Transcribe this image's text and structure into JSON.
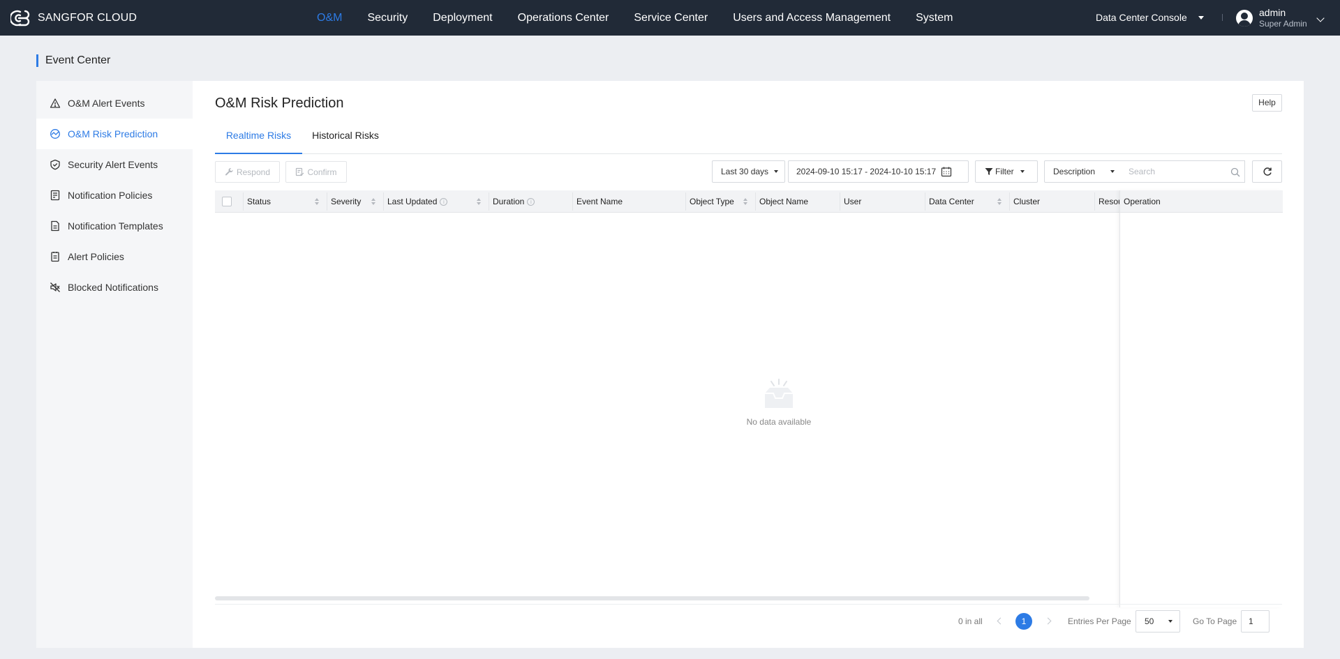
{
  "app": {
    "brand": "SANGFOR CLOUD"
  },
  "nav": {
    "items": [
      "O&M",
      "Security",
      "Deployment",
      "Operations Center",
      "Service Center",
      "Users and Access Management",
      "System"
    ],
    "active_index": 0,
    "console": "Data Center Console"
  },
  "user": {
    "name": "admin",
    "role": "Super Admin"
  },
  "page": {
    "title": "Event Center"
  },
  "sidebar": {
    "items": [
      {
        "label": "O&M Alert Events",
        "icon": "warning-icon"
      },
      {
        "label": "O&M Risk Prediction",
        "icon": "risk-icon"
      },
      {
        "label": "Security Alert Events",
        "icon": "shield-icon"
      },
      {
        "label": "Notification Policies",
        "icon": "notification-policy-icon"
      },
      {
        "label": "Notification Templates",
        "icon": "template-icon"
      },
      {
        "label": "Alert Policies",
        "icon": "alert-policy-icon"
      },
      {
        "label": "Blocked Notifications",
        "icon": "muted-speaker-icon"
      }
    ],
    "active_index": 1
  },
  "main": {
    "title": "O&M Risk Prediction",
    "help_label": "Help",
    "tabs": [
      "Realtime Risks",
      "Historical Risks"
    ],
    "active_tab": 0
  },
  "toolbar": {
    "respond_label": "Respond",
    "confirm_label": "Confirm",
    "time_range": "Last 30 days",
    "date_range": "2024-09-10 15:17 - 2024-10-10 15:17",
    "filter_label": "Filter",
    "search_field": "Description",
    "search_placeholder": "Search"
  },
  "table": {
    "columns": [
      "Status",
      "Severity",
      "Last Updated",
      "Duration",
      "Event Name",
      "Object Type",
      "Object Name",
      "User",
      "Data Center",
      "Cluster",
      "Resour",
      "Operation"
    ],
    "rows": [],
    "empty_text": "No data available"
  },
  "pagination": {
    "total_text": "0 in all",
    "current_page": "1",
    "entries_label": "Entries Per Page",
    "entries_value": "50",
    "goto_label": "Go To Page",
    "goto_value": "1"
  },
  "colors": {
    "accent": "#2d7be5",
    "topbar": "#212a37",
    "background": "#eceef2"
  }
}
